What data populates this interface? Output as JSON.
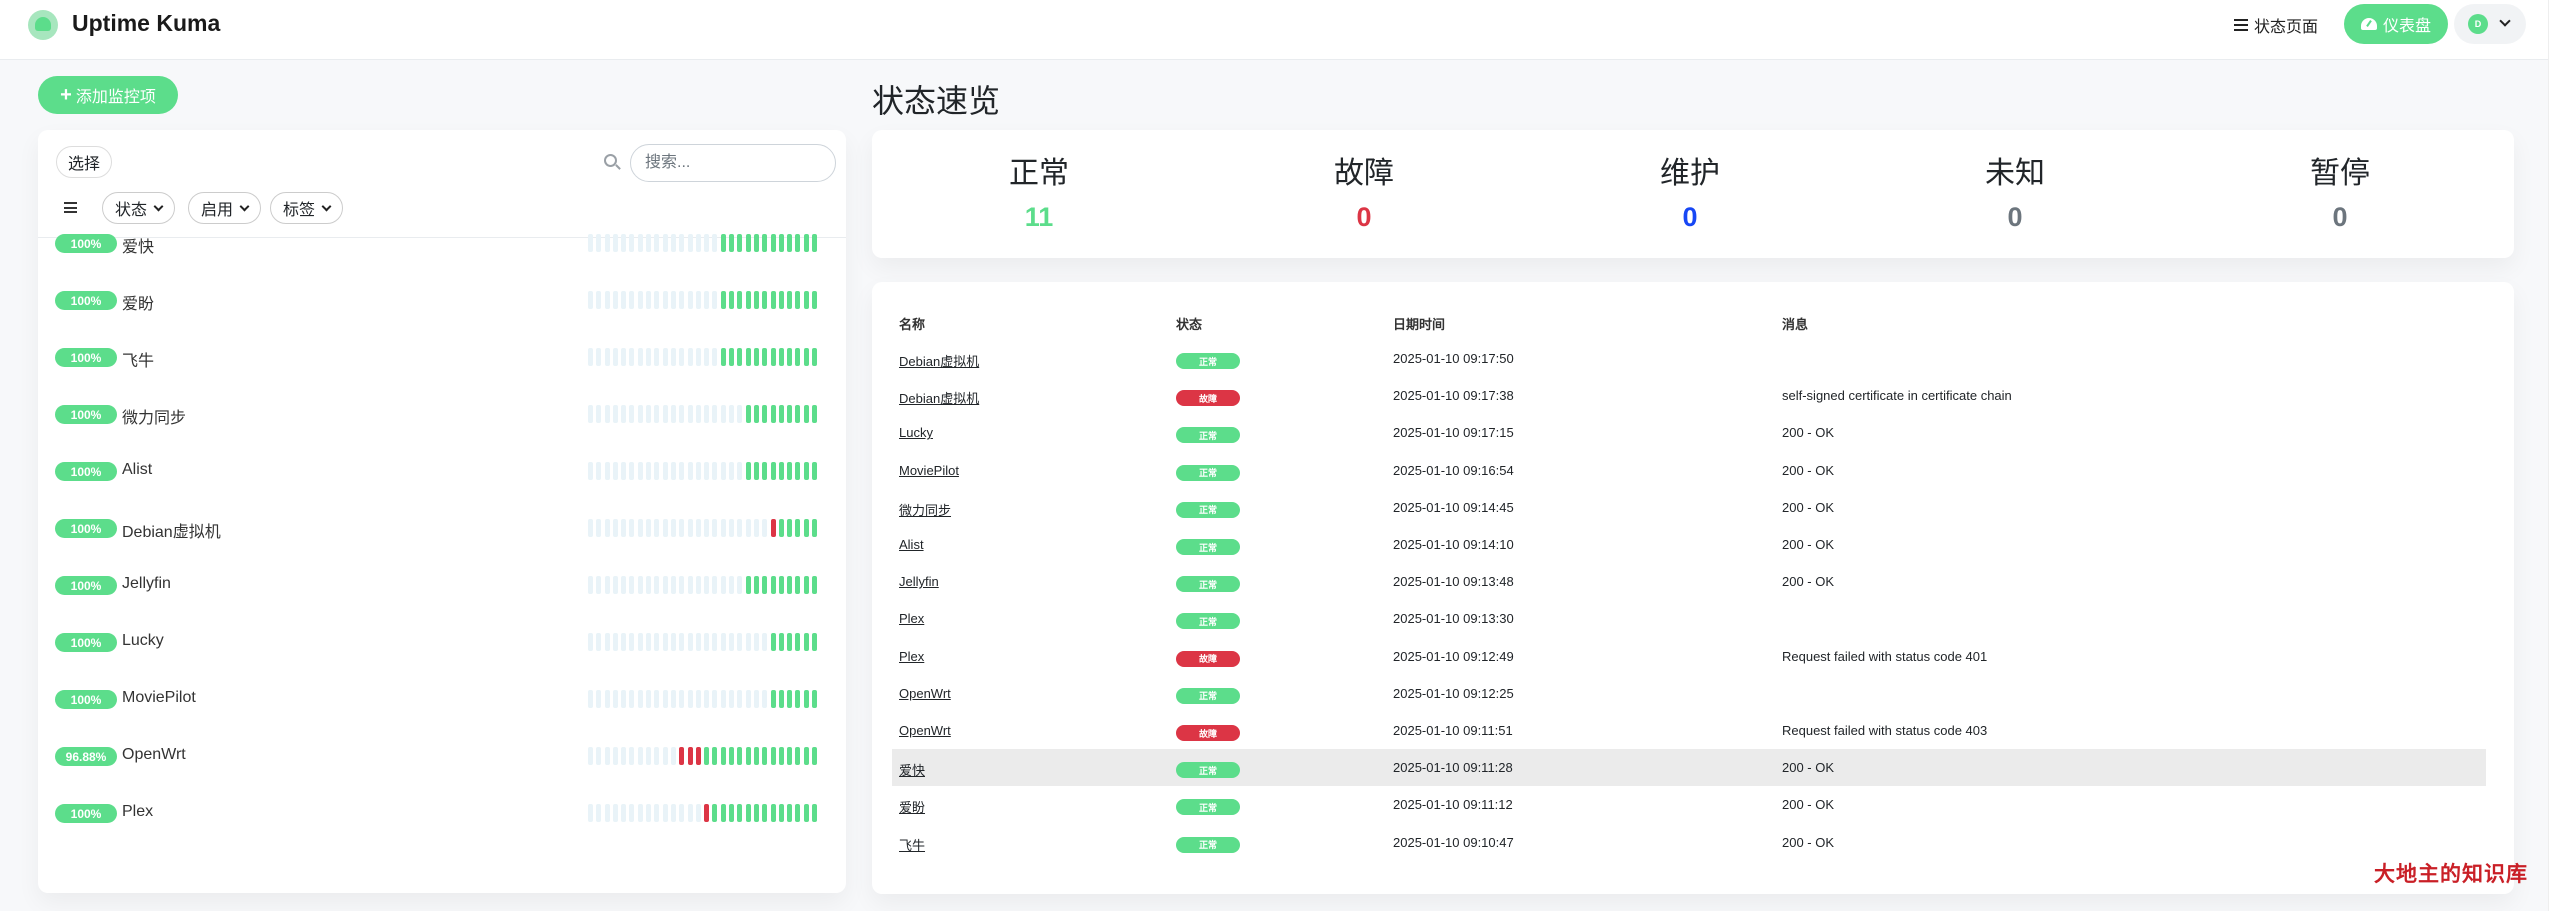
{
  "app": {
    "title": "Uptime Kuma"
  },
  "header": {
    "status_page_label": "状态页面",
    "dashboard_label": "仪表盘",
    "avatar_initial": "D"
  },
  "colors": {
    "accent": "#5cdd8b",
    "danger": "#dc3545",
    "maintenance": "#1747f5",
    "muted": "#6c757d"
  },
  "sidebar": {
    "add_monitor_label": "添加监控项",
    "select_label": "选择",
    "search_placeholder": "搜索...",
    "filters": [
      "状态",
      "启用",
      "标签"
    ],
    "monitors": [
      {
        "uptime": "100%",
        "name": "爱快",
        "beats": "................uuuuuuuuuuuu"
      },
      {
        "uptime": "100%",
        "name": "爱盼",
        "beats": "................uuuuuuuuuuuu"
      },
      {
        "uptime": "100%",
        "name": "飞牛",
        "beats": "................uuuuuuuuuuuu"
      },
      {
        "uptime": "100%",
        "name": "微力同步",
        "beats": "...................uuuuuuuuu"
      },
      {
        "uptime": "100%",
        "name": "Alist",
        "beats": "...................uuuuuuuuu"
      },
      {
        "uptime": "100%",
        "name": "Debian虚拟机",
        "beats": "......................duuuuu"
      },
      {
        "uptime": "100%",
        "name": "Jellyfin",
        "beats": "...................uuuuuuuuu"
      },
      {
        "uptime": "100%",
        "name": "Lucky",
        "beats": "......................uuuuuu"
      },
      {
        "uptime": "100%",
        "name": "MoviePilot",
        "beats": "......................uuuuuu"
      },
      {
        "uptime": "96.88%",
        "name": "OpenWrt",
        "beats": "...........ddduuuuuuuuuuuuuu"
      },
      {
        "uptime": "100%",
        "name": "Plex",
        "beats": "..............duuuuuuuuuuuuu"
      }
    ]
  },
  "overview": {
    "title": "状态速览",
    "stats": [
      {
        "label": "正常",
        "value": "11",
        "color": "#5cdd8b"
      },
      {
        "label": "故障",
        "value": "0",
        "color": "#dc3545"
      },
      {
        "label": "维护",
        "value": "0",
        "color": "#1747f5"
      },
      {
        "label": "未知",
        "value": "0",
        "color": "#6c757d"
      },
      {
        "label": "暂停",
        "value": "0",
        "color": "#6c757d"
      }
    ]
  },
  "events": {
    "columns": [
      "名称",
      "状态",
      "日期时间",
      "消息"
    ],
    "rows": [
      {
        "name": "Debian虚拟机",
        "status": "正常",
        "ok": true,
        "time": "2025-01-10 09:17:50",
        "msg": ""
      },
      {
        "name": "Debian虚拟机",
        "status": "故障",
        "ok": false,
        "time": "2025-01-10 09:17:38",
        "msg": "self-signed certificate in certificate chain"
      },
      {
        "name": "Lucky",
        "status": "正常",
        "ok": true,
        "time": "2025-01-10 09:17:15",
        "msg": "200 - OK"
      },
      {
        "name": "MoviePilot",
        "status": "正常",
        "ok": true,
        "time": "2025-01-10 09:16:54",
        "msg": "200 - OK"
      },
      {
        "name": "微力同步",
        "status": "正常",
        "ok": true,
        "time": "2025-01-10 09:14:45",
        "msg": "200 - OK"
      },
      {
        "name": "Alist",
        "status": "正常",
        "ok": true,
        "time": "2025-01-10 09:14:10",
        "msg": "200 - OK"
      },
      {
        "name": "Jellyfin",
        "status": "正常",
        "ok": true,
        "time": "2025-01-10 09:13:48",
        "msg": "200 - OK"
      },
      {
        "name": "Plex",
        "status": "正常",
        "ok": true,
        "time": "2025-01-10 09:13:30",
        "msg": ""
      },
      {
        "name": "Plex",
        "status": "故障",
        "ok": false,
        "time": "2025-01-10 09:12:49",
        "msg": "Request failed with status code 401"
      },
      {
        "name": "OpenWrt",
        "status": "正常",
        "ok": true,
        "time": "2025-01-10 09:12:25",
        "msg": ""
      },
      {
        "name": "OpenWrt",
        "status": "故障",
        "ok": false,
        "time": "2025-01-10 09:11:51",
        "msg": "Request failed with status code 403"
      },
      {
        "name": "爱快",
        "status": "正常",
        "ok": true,
        "time": "2025-01-10 09:11:28",
        "msg": "200 - OK",
        "highlight": true
      },
      {
        "name": "爱盼",
        "status": "正常",
        "ok": true,
        "time": "2025-01-10 09:11:12",
        "msg": "200 - OK"
      },
      {
        "name": "飞牛",
        "status": "正常",
        "ok": true,
        "time": "2025-01-10 09:10:47",
        "msg": "200 - OK"
      }
    ]
  },
  "watermark": "大地主的知识库"
}
